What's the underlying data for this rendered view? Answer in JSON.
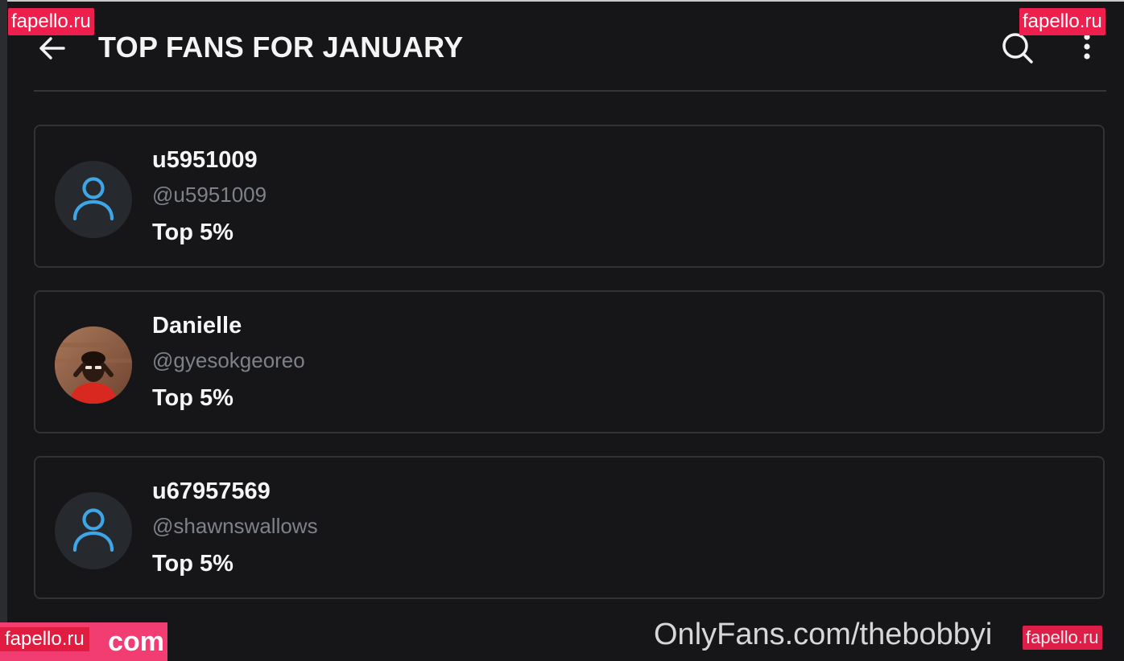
{
  "header": {
    "title": "TOP FANS FOR JANUARY",
    "back_icon": "arrow-left-icon",
    "search_icon": "search-icon",
    "more_icon": "more-vertical-icon"
  },
  "fans": [
    {
      "name": "u5951009",
      "handle": "@u5951009",
      "rank": "Top 5%",
      "avatar": "default-user-icon"
    },
    {
      "name": "Danielle",
      "handle": "@gyesokgeoreo",
      "rank": "Top 5%",
      "avatar": "profile-photo"
    },
    {
      "name": "u67957569",
      "handle": "@shawnswallows",
      "rank": "Top 5%",
      "avatar": "default-user-icon"
    }
  ],
  "watermarks": {
    "site": "fapello.ru",
    "bottom_left_suffix": "com",
    "footer_url": "OnlyFans.com/thebobbyi"
  },
  "colors": {
    "background": "#161619",
    "card_border": "#303236",
    "accent_icon": "#3ea6e6",
    "handle_text": "#7d8188",
    "watermark": "#ed1f4d"
  }
}
